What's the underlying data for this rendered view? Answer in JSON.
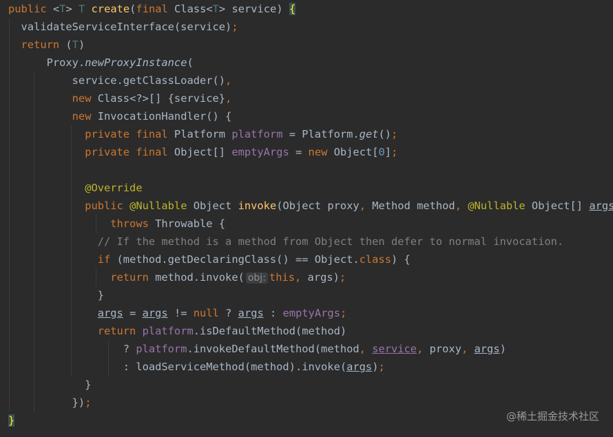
{
  "code": {
    "lines": [
      {
        "indent_guides": [],
        "tokens": [
          {
            "t": "public ",
            "c": "kw"
          },
          {
            "t": "<",
            "c": "id"
          },
          {
            "t": "T",
            "c": "tp"
          },
          {
            "t": "> ",
            "c": "id"
          },
          {
            "t": "T ",
            "c": "tp"
          },
          {
            "t": "create",
            "c": "fn"
          },
          {
            "t": "(",
            "c": "id"
          },
          {
            "t": "final ",
            "c": "kw"
          },
          {
            "t": "Class<",
            "c": "id"
          },
          {
            "t": "T",
            "c": "tp"
          },
          {
            "t": "> service) ",
            "c": "id"
          },
          {
            "t": "{",
            "c": "brace-hl"
          }
        ]
      },
      {
        "indent_guides": [
          1
        ],
        "tokens": [
          {
            "t": "  validateServiceInterface(service)",
            "c": "id"
          },
          {
            "t": ";",
            "c": "kw"
          }
        ]
      },
      {
        "indent_guides": [
          1
        ],
        "tokens": [
          {
            "t": "  return ",
            "c": "kw"
          },
          {
            "t": "(",
            "c": "id"
          },
          {
            "t": "T",
            "c": "tp"
          },
          {
            "t": ")",
            "c": "id"
          }
        ]
      },
      {
        "indent_guides": [
          1
        ],
        "tokens": [
          {
            "t": "      Proxy.",
            "c": "id"
          },
          {
            "t": "newProxyInstance",
            "c": "id ital"
          },
          {
            "t": "(",
            "c": "id"
          }
        ]
      },
      {
        "indent_guides": [
          1,
          2
        ],
        "tokens": [
          {
            "t": "          service.getClassLoader()",
            "c": "id"
          },
          {
            "t": ",",
            "c": "kw"
          }
        ]
      },
      {
        "indent_guides": [
          1,
          2
        ],
        "tokens": [
          {
            "t": "          new ",
            "c": "kw"
          },
          {
            "t": "Class<?>[] {service}",
            "c": "id"
          },
          {
            "t": ",",
            "c": "kw"
          }
        ]
      },
      {
        "indent_guides": [
          1,
          2
        ],
        "tokens": [
          {
            "t": "          new ",
            "c": "kw"
          },
          {
            "t": "InvocationHandler() {",
            "c": "id"
          }
        ]
      },
      {
        "indent_guides": [
          1,
          2,
          3
        ],
        "tokens": [
          {
            "t": "            private final ",
            "c": "kw"
          },
          {
            "t": "Platform ",
            "c": "id"
          },
          {
            "t": "platform ",
            "c": "fld"
          },
          {
            "t": "= Platform.",
            "c": "id"
          },
          {
            "t": "get",
            "c": "id ital"
          },
          {
            "t": "()",
            "c": "id"
          },
          {
            "t": ";",
            "c": "kw"
          }
        ]
      },
      {
        "indent_guides": [
          1,
          2,
          3
        ],
        "tokens": [
          {
            "t": "            private final ",
            "c": "kw"
          },
          {
            "t": "Object[] ",
            "c": "id"
          },
          {
            "t": "emptyArgs ",
            "c": "fld"
          },
          {
            "t": "= ",
            "c": "id"
          },
          {
            "t": "new ",
            "c": "kw"
          },
          {
            "t": "Object[",
            "c": "id"
          },
          {
            "t": "0",
            "c": "num"
          },
          {
            "t": "]",
            "c": "id"
          },
          {
            "t": ";",
            "c": "kw"
          }
        ]
      },
      {
        "indent_guides": [
          1,
          2,
          3
        ],
        "tokens": []
      },
      {
        "indent_guides": [
          1,
          2,
          3
        ],
        "tokens": [
          {
            "t": "            @Override",
            "c": "ann"
          }
        ]
      },
      {
        "indent_guides": [
          1,
          2,
          3
        ],
        "tokens": [
          {
            "t": "            public ",
            "c": "kw"
          },
          {
            "t": "@Nullable ",
            "c": "ann"
          },
          {
            "t": "Object ",
            "c": "id"
          },
          {
            "t": "invoke",
            "c": "fn"
          },
          {
            "t": "(Object proxy",
            "c": "id"
          },
          {
            "t": ", ",
            "c": "kw"
          },
          {
            "t": "Method method",
            "c": "id"
          },
          {
            "t": ", ",
            "c": "kw"
          },
          {
            "t": "@Nullable ",
            "c": "ann"
          },
          {
            "t": "Object[] ",
            "c": "id"
          },
          {
            "t": "args",
            "c": "id ul"
          },
          {
            "t": ")",
            "c": "id"
          }
        ]
      },
      {
        "indent_guides": [
          1,
          2,
          3,
          4
        ],
        "tokens": [
          {
            "t": "                throws ",
            "c": "kw"
          },
          {
            "t": "Throwable {",
            "c": "id"
          }
        ]
      },
      {
        "indent_guides": [
          1,
          2,
          3
        ],
        "tokens": [
          {
            "t": "              // If the method is a method from Object then defer to normal invocation.",
            "c": "cm"
          }
        ]
      },
      {
        "indent_guides": [
          1,
          2,
          3
        ],
        "tokens": [
          {
            "t": "              if ",
            "c": "kw"
          },
          {
            "t": "(method.getDeclaringClass() == Object.",
            "c": "id"
          },
          {
            "t": "class",
            "c": "kw"
          },
          {
            "t": ") {",
            "c": "id"
          }
        ]
      },
      {
        "indent_guides": [
          1,
          2,
          3,
          4
        ],
        "tokens": [
          {
            "t": "                return ",
            "c": "kw"
          },
          {
            "t": "method.invoke(",
            "c": "id"
          },
          {
            "t": "obj:",
            "c": "hint"
          },
          {
            "t": "this",
            "c": "kw"
          },
          {
            "t": ", ",
            "c": "kw"
          },
          {
            "t": "args)",
            "c": "id"
          },
          {
            "t": ";",
            "c": "kw"
          }
        ]
      },
      {
        "indent_guides": [
          1,
          2,
          3
        ],
        "tokens": [
          {
            "t": "              }",
            "c": "id"
          }
        ]
      },
      {
        "indent_guides": [
          1,
          2,
          3
        ],
        "tokens": [
          {
            "t": "              ",
            "c": "id"
          },
          {
            "t": "args",
            "c": "id ul"
          },
          {
            "t": " = ",
            "c": "id"
          },
          {
            "t": "args",
            "c": "id ul"
          },
          {
            "t": " != ",
            "c": "id"
          },
          {
            "t": "null ",
            "c": "kw"
          },
          {
            "t": "? ",
            "c": "id"
          },
          {
            "t": "args",
            "c": "id ul"
          },
          {
            "t": " : ",
            "c": "id"
          },
          {
            "t": "emptyArgs",
            "c": "fld"
          },
          {
            "t": ";",
            "c": "kw"
          }
        ]
      },
      {
        "indent_guides": [
          1,
          2,
          3
        ],
        "tokens": [
          {
            "t": "              return ",
            "c": "kw"
          },
          {
            "t": "platform",
            "c": "fld"
          },
          {
            "t": ".isDefaultMethod(method)",
            "c": "id"
          }
        ]
      },
      {
        "indent_guides": [
          1,
          2,
          3,
          5
        ],
        "tokens": [
          {
            "t": "                  ? ",
            "c": "id"
          },
          {
            "t": "platform",
            "c": "fld"
          },
          {
            "t": ".invokeDefaultMethod(method",
            "c": "id"
          },
          {
            "t": ", ",
            "c": "kw"
          },
          {
            "t": "service",
            "c": "fld ulf"
          },
          {
            "t": ", ",
            "c": "kw"
          },
          {
            "t": "proxy",
            "c": "id"
          },
          {
            "t": ", ",
            "c": "kw"
          },
          {
            "t": "args",
            "c": "id ul"
          },
          {
            "t": ")",
            "c": "id"
          }
        ]
      },
      {
        "indent_guides": [
          1,
          2,
          3,
          5
        ],
        "tokens": [
          {
            "t": "                  : loadServiceMethod(method).invoke(",
            "c": "id"
          },
          {
            "t": "args",
            "c": "id ul"
          },
          {
            "t": ")",
            "c": "id"
          },
          {
            "t": ";",
            "c": "kw"
          }
        ]
      },
      {
        "indent_guides": [
          1,
          2
        ],
        "tokens": [
          {
            "t": "            }",
            "c": "id"
          }
        ]
      },
      {
        "indent_guides": [
          1,
          2
        ],
        "tokens": [
          {
            "t": "          })",
            "c": "id"
          },
          {
            "t": ";",
            "c": "kw"
          }
        ]
      },
      {
        "indent_guides": [],
        "tokens": [
          {
            "t": "}",
            "c": "brace-hl"
          }
        ]
      }
    ]
  },
  "watermark": "@稀土掘金技术社区"
}
